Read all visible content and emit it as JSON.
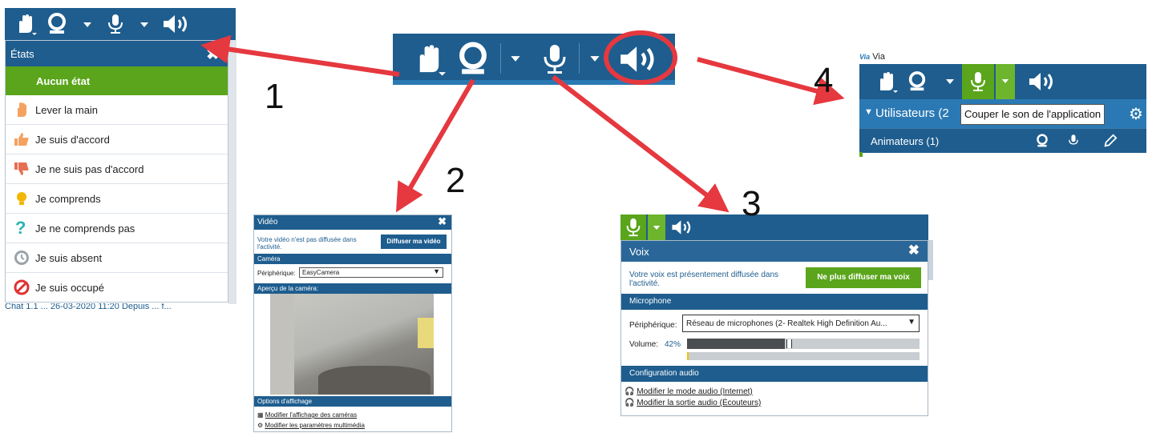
{
  "center_toolbar": {
    "icons": [
      "hand-icon",
      "webcam-icon",
      "chevron-down-icon",
      "microphone-icon",
      "chevron-down-icon",
      "speaker-icon"
    ],
    "highlight_color": "#e5383f"
  },
  "callouts": {
    "n1": "1",
    "n2": "2",
    "n3": "3",
    "n4": "4"
  },
  "panel1": {
    "title": "États",
    "active_state": "Aucun état",
    "states": [
      {
        "label": "Lever la main",
        "icon": "raise-hand-icon"
      },
      {
        "label": "Je suis d'accord",
        "icon": "thumbs-up-icon"
      },
      {
        "label": "Je ne suis pas d'accord",
        "icon": "thumbs-down-icon"
      },
      {
        "label": "Je comprends",
        "icon": "lightbulb-icon"
      },
      {
        "label": "Je ne comprends pas",
        "icon": "question-mark-icon"
      },
      {
        "label": "Je suis absent",
        "icon": "clock-icon"
      },
      {
        "label": "Je suis occupé",
        "icon": "busy-icon"
      }
    ],
    "footer_fragment": "Chat   1.1 ... 26-03-2020 11:20   Depuis ... f..."
  },
  "panel2": {
    "title": "Vidéo",
    "notice": "Votre vidéo n'est pas diffusée dans l'activité.",
    "broadcast_button": "Diffuser ma vidéo",
    "camera_section": "Caméra",
    "device_label": "Périphérique:",
    "device_value": "EasyCamera",
    "preview_section": "Aperçu de la caméra:",
    "display_section": "Options d'affichage",
    "link1": "Modifier l'affichage des caméras",
    "link2": "Modifier les paramètres multimédia"
  },
  "panel3": {
    "title": "Voix",
    "notice": "Votre voix est présentement diffusée dans l'activité.",
    "stop_button": "Ne plus diffuser ma voix",
    "mic_section": "Microphone",
    "device_label": "Périphérique:",
    "device_value": "Réseau de microphones (2- Realtek High Definition Au...",
    "volume_label": "Volume:",
    "volume_value": "42%",
    "volume_level": 0.42,
    "audio_section": "Configuration audio",
    "link1": "Modifier le mode audio (Internet)",
    "link2": "Modifier la sortie audio (Écouteurs)"
  },
  "panel4": {
    "app_name": "Via",
    "users_header": "Utilisateurs (2",
    "tooltip": "Couper le son de l'application",
    "animators": "Animateurs (1)"
  },
  "colors": {
    "brand_blue": "#1e5d8e",
    "green": "#5aa51b",
    "arrow_red": "#e5383f"
  }
}
